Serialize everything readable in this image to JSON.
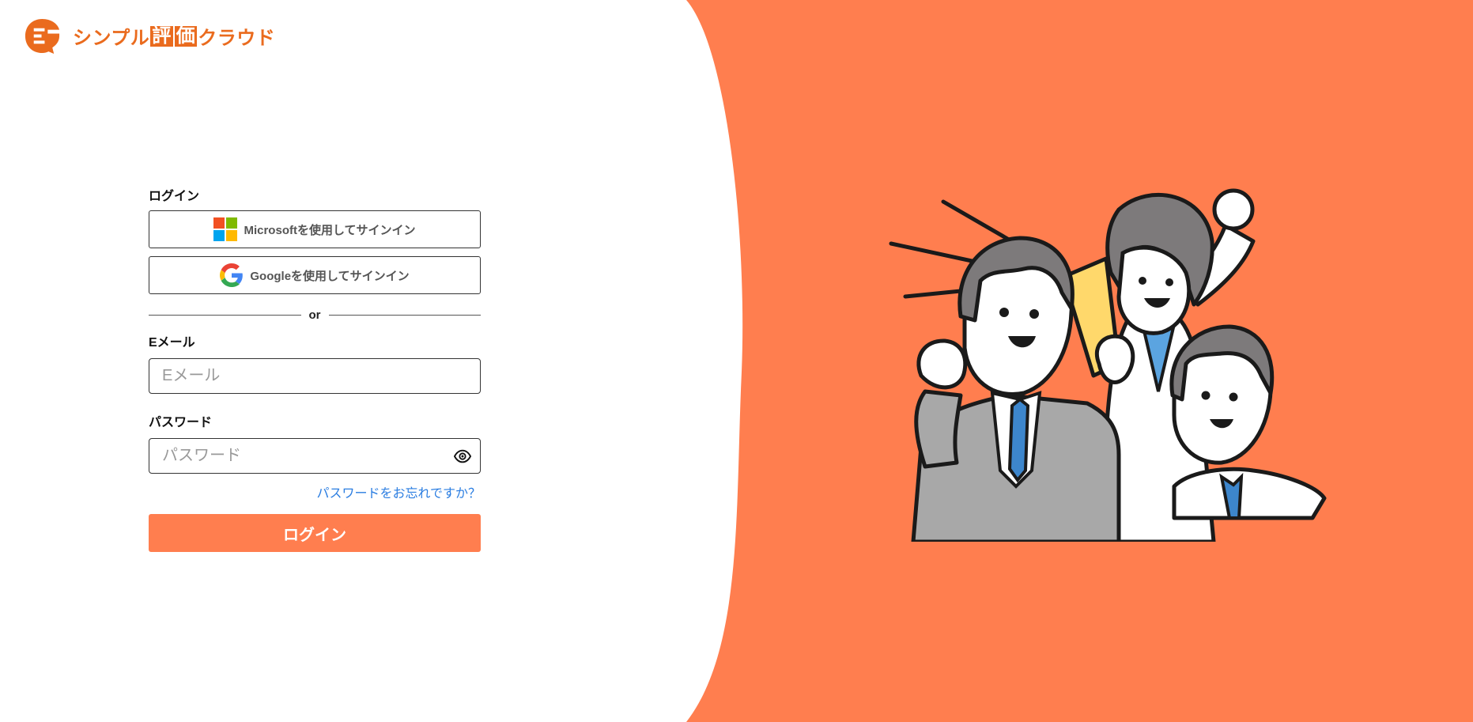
{
  "brand": {
    "name_part1": "シンプル",
    "name_box1": "評",
    "name_box2": "価",
    "name_part2": "クラウド",
    "logo_icon": "speech-bubble-e-icon"
  },
  "colors": {
    "brand_orange": "#ea6b1e",
    "panel_orange": "#ff7e4f",
    "login_button": "#ff7e4f",
    "link_blue": "#2a7de1"
  },
  "login": {
    "title": "ログイン",
    "microsoft_label": "Microsoftを使用してサインイン",
    "google_label": "Googleを使用してサインイン",
    "divider_text": "or",
    "email_label": "Eメール",
    "email_placeholder": "Eメール",
    "email_value": "",
    "password_label": "パスワード",
    "password_placeholder": "パスワード",
    "password_value": "",
    "password_toggle_icon": "eye-icon",
    "forgot_link": "パスワードをお忘れですか？",
    "submit_label": "ログイン"
  },
  "illustration": {
    "subject": "three-business-people-cheering-icon"
  }
}
